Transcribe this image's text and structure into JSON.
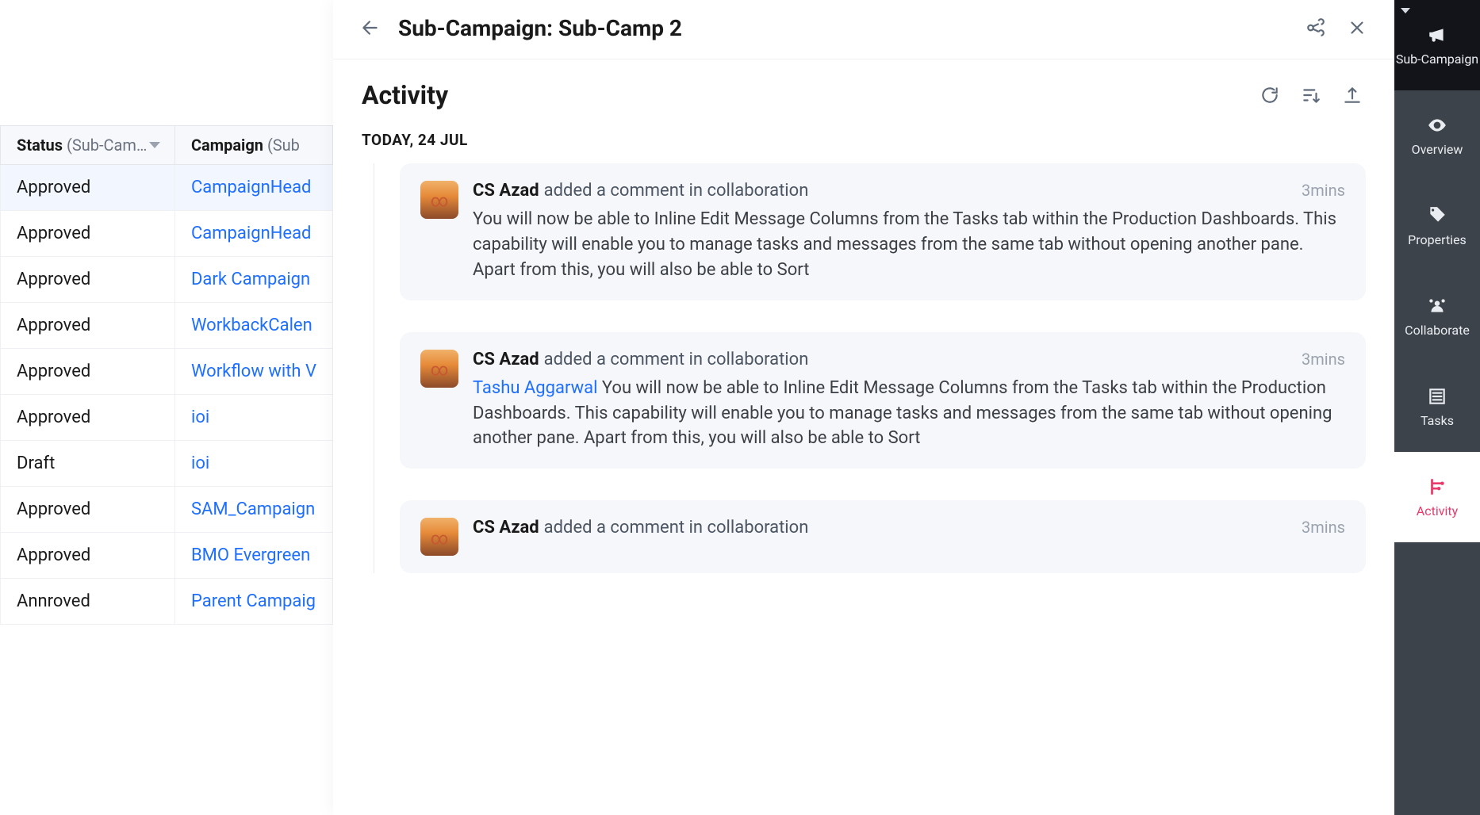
{
  "table": {
    "columns": [
      {
        "name": "Status",
        "sub": "(Sub-Cam…"
      },
      {
        "name": "Campaign",
        "sub": "(Sub"
      }
    ],
    "rows": [
      {
        "status": "Approved",
        "campaign": "CampaignHead",
        "selected": true
      },
      {
        "status": "Approved",
        "campaign": "CampaignHead"
      },
      {
        "status": "Approved",
        "campaign": "Dark Campaign"
      },
      {
        "status": "Approved",
        "campaign": "WorkbackCalen"
      },
      {
        "status": "Approved",
        "campaign": "Workflow with V"
      },
      {
        "status": "Approved",
        "campaign": "ioi"
      },
      {
        "status": "Draft",
        "campaign": "ioi"
      },
      {
        "status": "Approved",
        "campaign": "SAM_Campaign"
      },
      {
        "status": "Approved",
        "campaign": "BMO Evergreen"
      },
      {
        "status": "Annroved",
        "campaign": "Parent Campaig"
      }
    ]
  },
  "panel": {
    "title": "Sub-Campaign: Sub-Camp 2",
    "activity_title": "Activity",
    "date_label": "TODAY, 24 JUL",
    "entries": [
      {
        "author": "CS Azad",
        "action": "added a comment in collaboration",
        "time": "3mins",
        "mention": "",
        "text": "You will now be able to Inline Edit Message Columns from the Tasks tab within the Production Dashboards. This capability will enable you to man­age tasks and messages from the same tab without opening another pane. Apart from this, you will also be able to Sort"
      },
      {
        "author": "CS Azad",
        "action": "added a comment in collaboration",
        "time": "3mins",
        "mention": "Tashu Aggarwal",
        "text": "You will now be able to Inline Edit Message Columns from the Tasks tab within the Production Dashboards. This capability will enable you to manage tasks and messages from the same tab without opening an­other pane. Apart from this, you will also be able to Sort"
      },
      {
        "author": "CS Azad",
        "action": "added a comment in collaboration",
        "time": "3mins",
        "mention": "",
        "text": ""
      }
    ]
  },
  "rail": [
    {
      "id": "sub-campaign",
      "label": "Sub-Campaign",
      "icon": "megaphone",
      "variant": "dark"
    },
    {
      "id": "overview",
      "label": "Overview",
      "icon": "eye"
    },
    {
      "id": "properties",
      "label": "Properties",
      "icon": "tag"
    },
    {
      "id": "collaborate",
      "label": "Collaborate",
      "icon": "team"
    },
    {
      "id": "tasks",
      "label": "Tasks",
      "icon": "list"
    },
    {
      "id": "activity",
      "label": "Activity",
      "icon": "timeline",
      "variant": "active"
    }
  ]
}
